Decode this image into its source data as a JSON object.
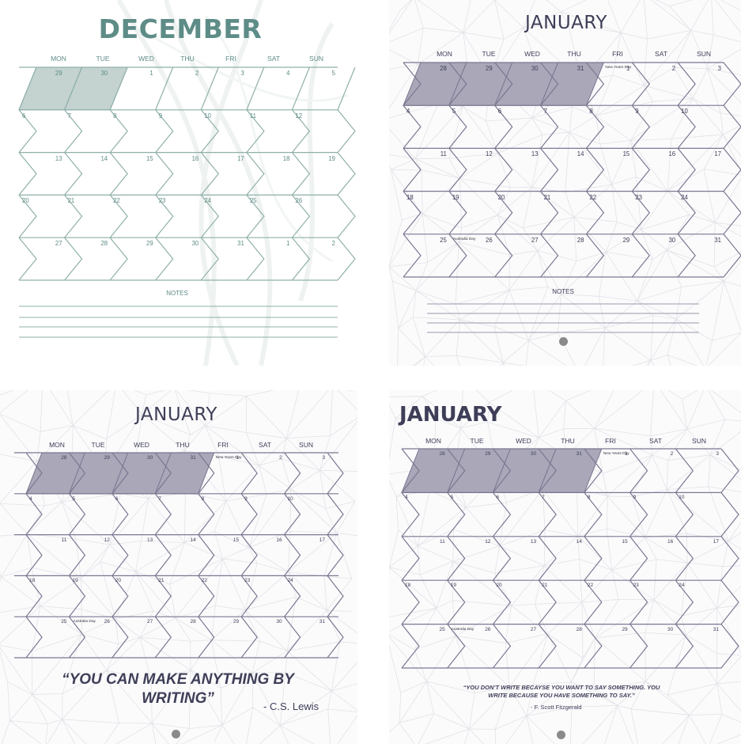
{
  "colors": {
    "dec_accent": "#5e8c87",
    "dec_line": "#8fb0a8",
    "dec_fill": "#c4d3d0",
    "dec_fill_stroke": "#7aa3c2",
    "jan_text": "#3e3e58",
    "jan_line": "#7a7891",
    "jan_fill": "#a9a7b8",
    "dot": "#8a8a8a",
    "texture": "#e3e3e8"
  },
  "pages": [
    {
      "id": "dec",
      "title": "DECEMBER",
      "days": [
        "MON",
        "TUE",
        "WED",
        "THU",
        "FRI",
        "SAT",
        "SUN"
      ],
      "weeks": [
        [
          "29",
          "30",
          "1",
          "2",
          "3",
          "4",
          "5"
        ],
        [
          "6",
          "7",
          "8",
          "9",
          "10",
          "11",
          "12"
        ],
        [
          "13",
          "14",
          "15",
          "16",
          "17",
          "18",
          "19"
        ],
        [
          "20",
          "21",
          "22",
          "23",
          "24",
          "25",
          "26"
        ],
        [
          "27",
          "28",
          "29",
          "30",
          "31",
          "1",
          "2"
        ]
      ],
      "holidays": [],
      "notes_label": "NOTES"
    },
    {
      "id": "jan1",
      "title": "JANUARY",
      "days": [
        "MON",
        "TUE",
        "WED",
        "THU",
        "FRI",
        "SAT",
        "SUN"
      ],
      "weeks": [
        [
          "28",
          "29",
          "30",
          "31",
          "1",
          "2",
          "3"
        ],
        [
          "4",
          "5",
          "6",
          "7",
          "8",
          "9",
          "10"
        ],
        [
          "11",
          "12",
          "13",
          "14",
          "15",
          "16",
          "17"
        ],
        [
          "18",
          "19",
          "20",
          "21",
          "22",
          "23",
          "24"
        ],
        [
          "25",
          "26",
          "27",
          "28",
          "29",
          "30",
          "31"
        ]
      ],
      "holidays": [
        {
          "week": 0,
          "day": 4,
          "label": "New Years Day"
        },
        {
          "week": 4,
          "day": 1,
          "label": "Australia Day"
        }
      ],
      "notes_label": "NOTES"
    },
    {
      "id": "jan2",
      "title": "JANUARY",
      "days": [
        "MON",
        "TUE",
        "WED",
        "THU",
        "FRI",
        "SAT",
        "SUN"
      ],
      "weeks": [
        [
          "28",
          "29",
          "30",
          "31",
          "1",
          "2",
          "3"
        ],
        [
          "4",
          "5",
          "6",
          "7",
          "8",
          "9",
          "10"
        ],
        [
          "11",
          "12",
          "13",
          "14",
          "15",
          "16",
          "17"
        ],
        [
          "18",
          "19",
          "20",
          "21",
          "22",
          "23",
          "24"
        ],
        [
          "25",
          "26",
          "27",
          "28",
          "29",
          "30",
          "31"
        ]
      ],
      "holidays": [
        {
          "week": 0,
          "day": 4,
          "label": "New Years Day"
        },
        {
          "week": 4,
          "day": 1,
          "label": "Australia Day"
        }
      ],
      "quote_text": "“YOU CAN MAKE ANYTHING BY WRITING”",
      "quote_author": "- C.S. Lewis"
    },
    {
      "id": "jan3",
      "title": "JANUARY",
      "days": [
        "MON",
        "TUE",
        "WED",
        "THU",
        "FRI",
        "SAT",
        "SUN"
      ],
      "weeks": [
        [
          "28",
          "29",
          "30",
          "31",
          "1",
          "2",
          "3"
        ],
        [
          "4",
          "5",
          "6",
          "7",
          "8",
          "9",
          "10"
        ],
        [
          "11",
          "12",
          "13",
          "14",
          "15",
          "16",
          "17"
        ],
        [
          "18",
          "19",
          "20",
          "21",
          "22",
          "23",
          "24"
        ],
        [
          "25",
          "26",
          "27",
          "28",
          "29",
          "30",
          "31"
        ]
      ],
      "holidays": [
        {
          "week": 0,
          "day": 4,
          "label": "New Years Day"
        },
        {
          "week": 4,
          "day": 1,
          "label": "Australia Day"
        }
      ],
      "quote_text": "“YOU DON’T WRITE BECAYSE YOU WANT TO SAY SOMETHING. YOU WRITE BECAUSE YOU HAVE SOMETHING TO SAY.”",
      "quote_author": "- F. Scott Fitzgerald"
    }
  ]
}
